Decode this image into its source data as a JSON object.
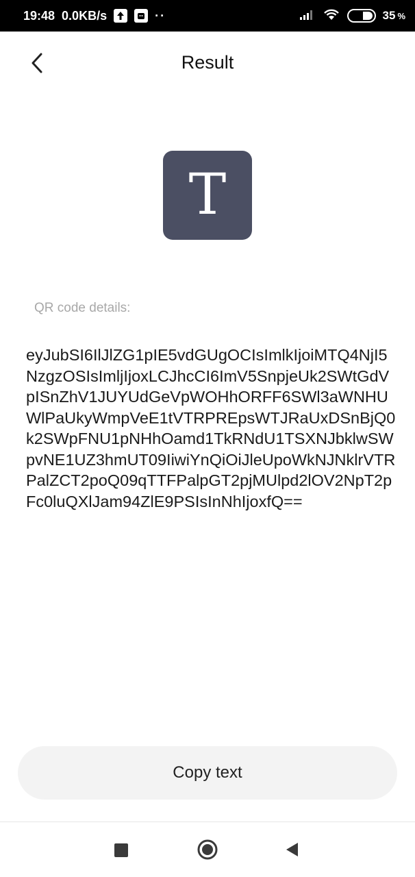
{
  "status_bar": {
    "time": "19:48",
    "speed": "0.0KB/s",
    "dots": "··",
    "battery": "35",
    "battery_unit": "%"
  },
  "header": {
    "title": "Result",
    "back_icon": "chevron-left-icon"
  },
  "content": {
    "type_icon_letter": "T",
    "details_label": "QR code details:",
    "qr_text": "eyJubSI6IlJlZG1pIE5vdGUgOCIsImlkIjoiMTQ4NjI5NzgzOSIsImljIjoxLCJhcCI6ImV5SnpjeUk2SWtGdVpISnZhV1JUYUdGeVpWOHhORFF6SWl3aWNHUWlPaUkyWmpVeE1tVTRPREpsWTJRaUxDSnBjQ0k2SWpFNU1pNHhOamd1TkRNdU1TSXNJbklwSWpvNE1UZ3hmUT09IiwiYnQiOiJleUpoWkNJNklrVTRPalZCT2poQ09qTTFPalpGT2pjMUlpd2lOV2NpT2pFc0luQXlJam94ZlE9PSIsInNhIjoxfQ=="
  },
  "actions": {
    "copy_label": "Copy text"
  },
  "colors": {
    "icon_tile": "#4b4f63",
    "button_bg": "#f3f3f3",
    "label_gray": "#a8a8a8"
  }
}
